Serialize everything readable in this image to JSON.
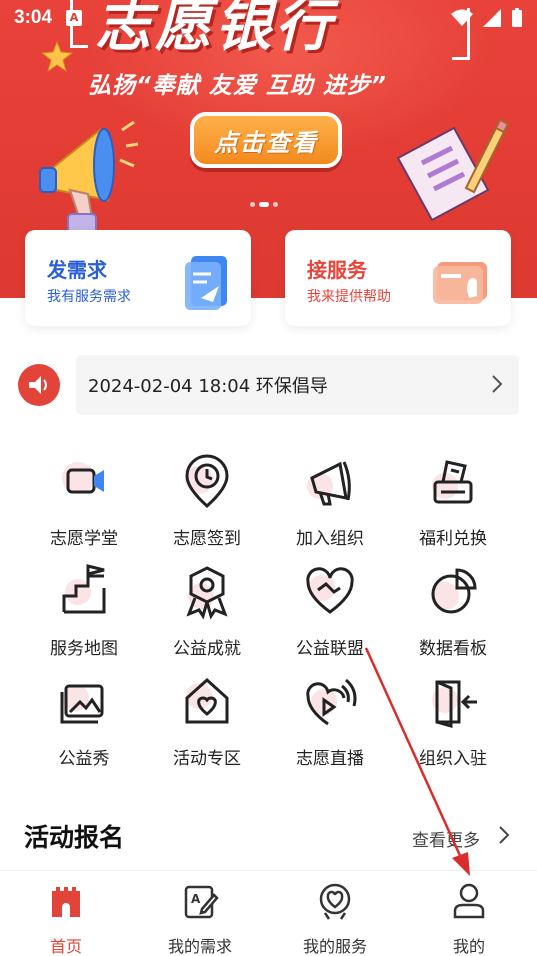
{
  "status_bar": {
    "time": "3:04",
    "notif_badge": "A"
  },
  "banner": {
    "title": "志愿银行",
    "slogan": "弘扬“奉献 友爱 互助 进步”",
    "button_label": "点击查看",
    "active_slide": 2,
    "slide_count": 3
  },
  "action_cards": [
    {
      "title": "发需求",
      "subtitle": "我有服务需求",
      "icon": "paper-plane-document-icon"
    },
    {
      "title": "接服务",
      "subtitle": "我来提供帮助",
      "icon": "chat-hand-icon"
    }
  ],
  "notice": {
    "text": "2024-02-04 18:04 环保倡导",
    "icon": "speaker-icon"
  },
  "grid": [
    {
      "label": "志愿学堂",
      "icon": "video-camera-icon"
    },
    {
      "label": "志愿签到",
      "icon": "clock-pin-icon"
    },
    {
      "label": "加入组织",
      "icon": "megaphone-icon"
    },
    {
      "label": "福利兑换",
      "icon": "gift-box-icon"
    },
    {
      "label": "服务地图",
      "icon": "flag-map-icon"
    },
    {
      "label": "公益成就",
      "icon": "medal-icon"
    },
    {
      "label": "公益联盟",
      "icon": "heart-handshake-icon"
    },
    {
      "label": "数据看板",
      "icon": "pie-chart-icon"
    },
    {
      "label": "公益秀",
      "icon": "image-gallery-icon"
    },
    {
      "label": "活动专区",
      "icon": "house-heart-icon"
    },
    {
      "label": "志愿直播",
      "icon": "live-heart-icon"
    },
    {
      "label": "组织入驻",
      "icon": "door-enter-icon"
    }
  ],
  "section": {
    "title": "活动报名",
    "more": "查看更多"
  },
  "tabbar": [
    {
      "label": "首页",
      "icon": "home-castle-icon",
      "active": true
    },
    {
      "label": "我的需求",
      "icon": "edit-document-icon",
      "active": false
    },
    {
      "label": "我的服务",
      "icon": "heart-badge-icon",
      "active": false
    },
    {
      "label": "我的",
      "icon": "user-icon",
      "active": false
    }
  ],
  "colors": {
    "brand_red": "#e2443a",
    "blue": "#2a5fd6",
    "orange": "#f28a1e"
  }
}
